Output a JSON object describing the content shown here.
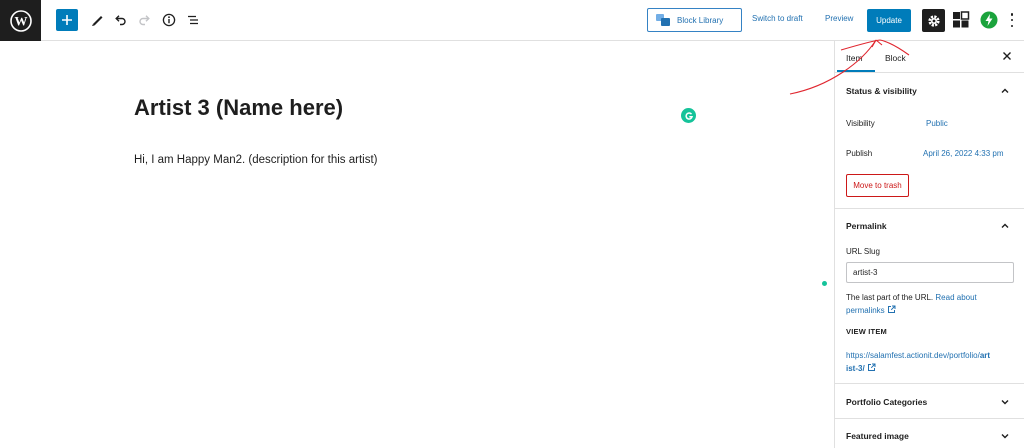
{
  "toolbar": {
    "block_library_label": "Block Library",
    "switch_to_draft_label": "Switch to draft",
    "preview_label": "Preview",
    "update_label": "Update",
    "icons": [
      "wordpress-logo-icon",
      "plus-icon",
      "pencil-icon",
      "undo-icon",
      "redo-icon",
      "info-icon",
      "list-view-icon",
      "block-library-icon",
      "gear-icon",
      "plugin-blocks-icon",
      "bolt-icon",
      "more-vertical-icon"
    ]
  },
  "editor": {
    "title": "Artist 3 (Name here)",
    "paragraph": "Hi, I am Happy Man2. (description for this artist)"
  },
  "sidebar": {
    "tabs": {
      "item": "Item",
      "block": "Block"
    },
    "status": {
      "title": "Status & visibility",
      "visibility_label": "Visibility",
      "visibility_value": "Public",
      "publish_label": "Publish",
      "publish_value": "April 26, 2022 4:33 pm",
      "trash_label": "Move to trash"
    },
    "permalink": {
      "title": "Permalink",
      "slug_label": "URL Slug",
      "slug_value": "artist-3",
      "help_text": "The last part of the URL.",
      "read_about": "Read about permalinks",
      "view_item_label": "VIEW ITEM",
      "url_prefix": "https://salamfest.actionit.dev/portfolio/",
      "url_slug": "artist-3/"
    },
    "portfolio_categories_title": "Portfolio Categories",
    "featured_image_title": "Featured image"
  },
  "colors": {
    "accent": "#007cba",
    "link": "#2271b1",
    "danger": "#cc1818",
    "annotation": "#e0262f",
    "grammarly": "#15c39a"
  }
}
